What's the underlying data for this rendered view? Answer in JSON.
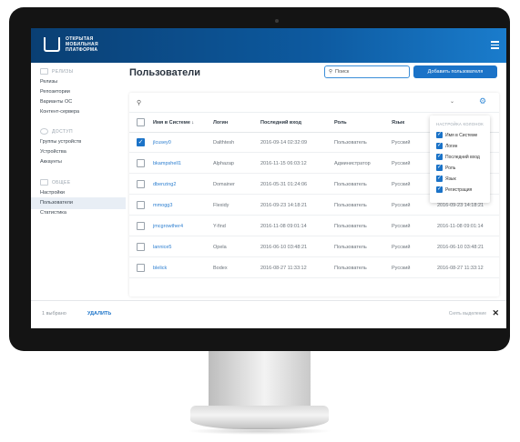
{
  "header": {
    "logo_lines": [
      "ОТКРЫТАЯ",
      "МОБИЛЬНАЯ",
      "ПЛАТФОРМА"
    ]
  },
  "sidebar": {
    "sections": [
      {
        "title": "РЕЛИЗЫ",
        "items": [
          "Релизы",
          "Репозитории",
          "Варианты ОС",
          "Контент-сервера"
        ]
      },
      {
        "title": "ДОСТУП",
        "items": [
          "Группы устройств",
          "Устройства",
          "Аккаунты"
        ]
      },
      {
        "title": "ОБЩЕЕ",
        "items": [
          "Настройки",
          "Пользователи",
          "Статистика"
        ]
      }
    ],
    "active_item": "Пользователи"
  },
  "main": {
    "page_title": "Пользователи",
    "search_placeholder": "Поиск",
    "add_button": "Добавить пользователя"
  },
  "table": {
    "columns": [
      "Имя в Системе",
      "Логин",
      "Последний вход",
      "Роль",
      "Язык",
      "Регистрация"
    ],
    "sort_arrow": "↓",
    "rows": [
      {
        "name": "jlcusey0",
        "login": "Dalthtesh",
        "last": "2016-09-14 02:32:09",
        "role": "Пользователь",
        "lang": "Русский",
        "reg": "",
        "checked": true
      },
      {
        "name": "bkampshell1",
        "login": "Alphazap",
        "last": "2016-11-15 06:03:12",
        "role": "Администратор",
        "lang": "Русский",
        "reg": "",
        "checked": false
      },
      {
        "name": "dbenzing2",
        "login": "Domainer",
        "last": "2016-05-31 01:24:06",
        "role": "Пользователь",
        "lang": "Русский",
        "reg": "",
        "checked": false
      },
      {
        "name": "mmogg3",
        "login": "Flexidy",
        "last": "2016-09-23 14:18:21",
        "role": "Пользователь",
        "lang": "Русский",
        "reg": "2016-09-23 14:18:21",
        "checked": false
      },
      {
        "name": "jmcgrowther4",
        "login": "Y-find",
        "last": "2016-11-08 09:01:14",
        "role": "Пользователь",
        "lang": "Русский",
        "reg": "2016-11-08 09:01:14",
        "checked": false
      },
      {
        "name": "lannice5",
        "login": "Opela",
        "last": "2016-06-10 03:48:21",
        "role": "Пользователь",
        "lang": "Русский",
        "reg": "2016-06-10 03:48:21",
        "checked": false
      },
      {
        "name": "blelick",
        "login": "Bodex",
        "last": "2016-08-27 11:33:12",
        "role": "Пользователь",
        "lang": "Русский",
        "reg": "2016-08-27 11:33:12",
        "checked": false
      }
    ]
  },
  "column_settings": {
    "title": "НАСТРОЙКА КОЛОНОК",
    "items": [
      "Имя в Системе",
      "Логин",
      "Последний вход",
      "Роль",
      "Язык",
      "Регистрация"
    ]
  },
  "bottom_bar": {
    "selected": "1 выбрано",
    "delete": "УДАЛИТЬ",
    "clear": "Снять выделение",
    "close": "✕"
  },
  "colors": {
    "header_start": "#0a3f73",
    "header_end": "#1a7ccc",
    "accent": "#1b73c8",
    "link": "#2d7fd0"
  }
}
